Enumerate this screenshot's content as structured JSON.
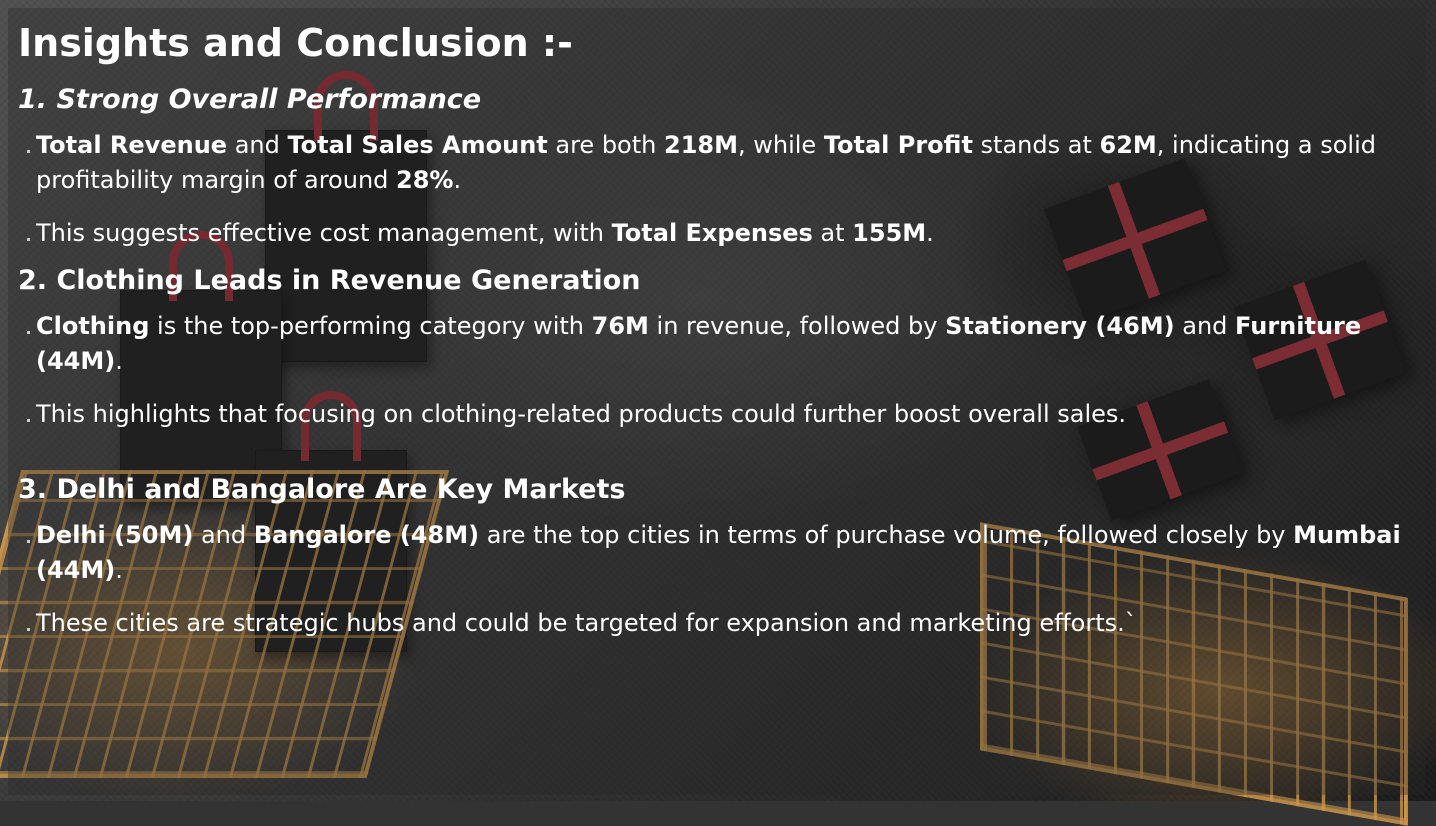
{
  "title": "Insights and Conclusion :-",
  "sections": [
    {
      "heading": "1. Strong Overall Performance",
      "paragraphs": [
        [
          {
            "t": "Total Revenue",
            "b": true
          },
          {
            "t": " and ",
            "b": false
          },
          {
            "t": "Total Sales Amount",
            "b": true
          },
          {
            "t": " are both ",
            "b": false
          },
          {
            "t": "218M",
            "b": true
          },
          {
            "t": ", while ",
            "b": false
          },
          {
            "t": "Total Profit",
            "b": true
          },
          {
            "t": " stands at ",
            "b": false
          },
          {
            "t": "62M",
            "b": true
          },
          {
            "t": ", indicating a solid profitability margin of around ",
            "b": false
          },
          {
            "t": "28%",
            "b": true
          },
          {
            "t": ".",
            "b": false
          }
        ],
        [
          {
            "t": "This suggests effective cost management, with ",
            "b": false
          },
          {
            "t": "Total Expenses",
            "b": true
          },
          {
            "t": " at ",
            "b": false
          },
          {
            "t": "155M",
            "b": true
          },
          {
            "t": ".",
            "b": false
          }
        ]
      ]
    },
    {
      "heading": "2. Clothing Leads in Revenue Generation",
      "paragraphs": [
        [
          {
            "t": "Clothing",
            "b": true
          },
          {
            "t": " is the top-performing category with ",
            "b": false
          },
          {
            "t": "76M",
            "b": true
          },
          {
            "t": " in revenue, followed by ",
            "b": false
          },
          {
            "t": "Stationery (46M)",
            "b": true
          },
          {
            "t": " and ",
            "b": false
          },
          {
            "t": "Furniture (44M)",
            "b": true
          },
          {
            "t": ".",
            "b": false
          }
        ],
        [
          {
            "t": "This highlights that focusing on clothing-related products could further boost overall sales.",
            "b": false
          }
        ]
      ]
    },
    {
      "heading": "3. Delhi and Bangalore Are Key Markets",
      "paragraphs": [
        [
          {
            "t": "Delhi (50M)",
            "b": true
          },
          {
            "t": " and ",
            "b": false
          },
          {
            "t": "Bangalore (48M)",
            "b": true
          },
          {
            "t": " are the top cities in terms of purchase volume, followed closely by ",
            "b": false
          },
          {
            "t": "Mumbai (44M)",
            "b": true
          },
          {
            "t": ".",
            "b": false
          }
        ],
        [
          {
            "t": "These cities are strategic hubs and could be targeted for expansion and marketing efforts.`",
            "b": false
          }
        ]
      ]
    }
  ]
}
